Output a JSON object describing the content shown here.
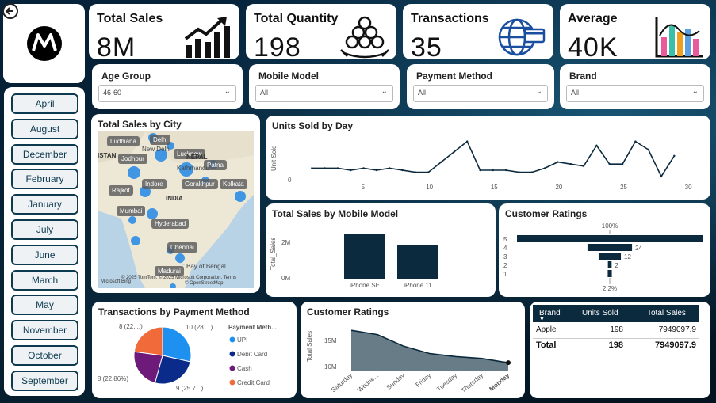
{
  "nav": {
    "back_icon": "back-arrow-icon"
  },
  "logo": {
    "icon": "motorola-logo"
  },
  "kpis": [
    {
      "label": "Total Sales",
      "value": "8M",
      "icon": "growth-chart-icon"
    },
    {
      "label": "Total Quantity",
      "value": "198",
      "icon": "stacked-coins-icon"
    },
    {
      "label": "Transactions",
      "value": "35",
      "icon": "globe-card-icon"
    },
    {
      "label": "Average",
      "value": "40K",
      "icon": "bar-chart-icon"
    }
  ],
  "slicers": [
    {
      "label": "Age Group",
      "value": "46-60"
    },
    {
      "label": "Mobile Model",
      "value": "All"
    },
    {
      "label": "Payment Method",
      "value": "All"
    },
    {
      "label": "Brand",
      "value": "All"
    }
  ],
  "months": [
    "April",
    "August",
    "December",
    "February",
    "January",
    "July",
    "June",
    "March",
    "May",
    "November",
    "October",
    "September"
  ],
  "map": {
    "title": "Total Sales by City",
    "country_labels": [
      "ISTAN",
      "INDIA",
      "NEPAL"
    ],
    "cities": [
      "Ludhiana",
      "Delhi",
      "New Delhi",
      "Lucknow",
      "Jodhpur",
      "Patna",
      "Kathmandu",
      "Indore",
      "Gorakhpur",
      "Kolkata",
      "Rajkot",
      "Mumbai",
      "Hyderabad",
      "Chennai",
      "Madurai",
      "Bay of Bengal"
    ],
    "attribution": "© 2025 TomTom, © 2025 Microsoft Corporation, Terms",
    "attribution2": "© OpenStreetMap",
    "brand": "Microsoft Bing"
  },
  "units_by_day": {
    "title": "Units Sold by Day",
    "ylabel": "Unit Sold",
    "ytick": "0",
    "xticks": [
      "5",
      "10",
      "15",
      "20",
      "25",
      "30"
    ]
  },
  "sales_by_model": {
    "title": "Total Sales by Mobile Model",
    "ylabel": "Total_Sales",
    "yticks": [
      "2M",
      "0M"
    ],
    "categories": [
      "iPhone SE",
      "iPhone 11"
    ]
  },
  "funnel": {
    "title": "Customer Ratings",
    "top_pct": "100%",
    "bottom_pct": "2.2%",
    "labels": [
      "5",
      "4",
      "3",
      "2",
      "1"
    ],
    "value_labels": [
      "",
      "24",
      "12",
      "2",
      ""
    ]
  },
  "pie": {
    "title": "Transactions by Payment Method",
    "legend_title": "Payment Meth...",
    "legend": [
      "UPI",
      "Debit Card",
      "Cash",
      "Credit Card"
    ],
    "slice_labels": [
      "10 (28....)",
      "9 (25.7...)",
      "8 (22.86%)",
      "8 (22....)"
    ]
  },
  "area": {
    "title": "Customer Ratings",
    "ylabel": "Total Sales",
    "yticks": [
      "15M",
      "10M"
    ],
    "xticks": [
      "Saturday",
      "Wedne...",
      "Sunday",
      "Friday",
      "Tuesday",
      "Thursday",
      "Monday"
    ]
  },
  "table": {
    "headers": [
      "Brand",
      "Units Sold",
      "Total Sales"
    ],
    "rows": [
      [
        "Apple",
        "198",
        "7949097.9"
      ]
    ],
    "total": [
      "Total",
      "198",
      "7949097.9"
    ]
  },
  "colors": {
    "navy": "#0c2a3e",
    "upi": "#1e90f0",
    "debit": "#0b2b8a",
    "cash": "#6e1a7a",
    "credit": "#f06a3a",
    "area": "#5f7580"
  },
  "chart_data": [
    {
      "type": "line",
      "title": "Units Sold by Day",
      "ylabel": "Unit Sold",
      "x": [
        1,
        2,
        3,
        4,
        5,
        6,
        7,
        8,
        9,
        10,
        11,
        12,
        13,
        14,
        15,
        16,
        17,
        18,
        19,
        20,
        21,
        22,
        23,
        24,
        25,
        26,
        27,
        28,
        29
      ],
      "values": [
        6,
        6,
        6,
        5,
        6,
        5,
        6,
        5,
        4,
        4,
        9,
        14,
        19,
        5,
        5,
        5,
        4,
        4,
        6,
        9,
        8,
        7,
        17,
        8,
        8,
        19,
        15,
        2,
        12
      ],
      "xlim": [
        0,
        31
      ],
      "ylim": [
        0,
        20
      ]
    },
    {
      "type": "bar",
      "title": "Total Sales by Mobile Model",
      "categories": [
        "iPhone SE",
        "iPhone 11"
      ],
      "values": [
        2.5,
        1.9
      ],
      "ylabel": "Total_Sales",
      "ylim": [
        0,
        2.6
      ]
    },
    {
      "type": "bar",
      "title": "Customer Ratings",
      "categories": [
        "5",
        "4",
        "3",
        "2",
        "1"
      ],
      "values": [
        100,
        24,
        12,
        2,
        2.2
      ]
    },
    {
      "type": "pie",
      "title": "Transactions by Payment Method",
      "categories": [
        "UPI",
        "Debit Card",
        "Cash",
        "Credit Card"
      ],
      "values": [
        10,
        9,
        8,
        8
      ]
    },
    {
      "type": "area",
      "title": "Customer Ratings",
      "ylabel": "Total Sales",
      "categories": [
        "Saturday",
        "Wednesday",
        "Sunday",
        "Friday",
        "Tuesday",
        "Thursday",
        "Monday"
      ],
      "values": [
        16.2,
        15.5,
        13.6,
        12.4,
        11.9,
        11.6,
        10.9
      ],
      "ylim": [
        9.5,
        17
      ]
    }
  ]
}
